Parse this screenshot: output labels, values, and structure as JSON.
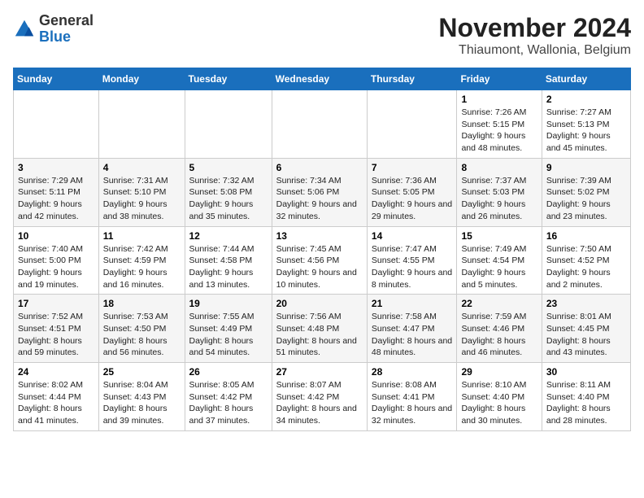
{
  "logo": {
    "text_general": "General",
    "text_blue": "Blue"
  },
  "header": {
    "month": "November 2024",
    "location": "Thiaumont, Wallonia, Belgium"
  },
  "days_of_week": [
    "Sunday",
    "Monday",
    "Tuesday",
    "Wednesday",
    "Thursday",
    "Friday",
    "Saturday"
  ],
  "weeks": [
    [
      {
        "day": "",
        "info": ""
      },
      {
        "day": "",
        "info": ""
      },
      {
        "day": "",
        "info": ""
      },
      {
        "day": "",
        "info": ""
      },
      {
        "day": "",
        "info": ""
      },
      {
        "day": "1",
        "info": "Sunrise: 7:26 AM\nSunset: 5:15 PM\nDaylight: 9 hours and 48 minutes."
      },
      {
        "day": "2",
        "info": "Sunrise: 7:27 AM\nSunset: 5:13 PM\nDaylight: 9 hours and 45 minutes."
      }
    ],
    [
      {
        "day": "3",
        "info": "Sunrise: 7:29 AM\nSunset: 5:11 PM\nDaylight: 9 hours and 42 minutes."
      },
      {
        "day": "4",
        "info": "Sunrise: 7:31 AM\nSunset: 5:10 PM\nDaylight: 9 hours and 38 minutes."
      },
      {
        "day": "5",
        "info": "Sunrise: 7:32 AM\nSunset: 5:08 PM\nDaylight: 9 hours and 35 minutes."
      },
      {
        "day": "6",
        "info": "Sunrise: 7:34 AM\nSunset: 5:06 PM\nDaylight: 9 hours and 32 minutes."
      },
      {
        "day": "7",
        "info": "Sunrise: 7:36 AM\nSunset: 5:05 PM\nDaylight: 9 hours and 29 minutes."
      },
      {
        "day": "8",
        "info": "Sunrise: 7:37 AM\nSunset: 5:03 PM\nDaylight: 9 hours and 26 minutes."
      },
      {
        "day": "9",
        "info": "Sunrise: 7:39 AM\nSunset: 5:02 PM\nDaylight: 9 hours and 23 minutes."
      }
    ],
    [
      {
        "day": "10",
        "info": "Sunrise: 7:40 AM\nSunset: 5:00 PM\nDaylight: 9 hours and 19 minutes."
      },
      {
        "day": "11",
        "info": "Sunrise: 7:42 AM\nSunset: 4:59 PM\nDaylight: 9 hours and 16 minutes."
      },
      {
        "day": "12",
        "info": "Sunrise: 7:44 AM\nSunset: 4:58 PM\nDaylight: 9 hours and 13 minutes."
      },
      {
        "day": "13",
        "info": "Sunrise: 7:45 AM\nSunset: 4:56 PM\nDaylight: 9 hours and 10 minutes."
      },
      {
        "day": "14",
        "info": "Sunrise: 7:47 AM\nSunset: 4:55 PM\nDaylight: 9 hours and 8 minutes."
      },
      {
        "day": "15",
        "info": "Sunrise: 7:49 AM\nSunset: 4:54 PM\nDaylight: 9 hours and 5 minutes."
      },
      {
        "day": "16",
        "info": "Sunrise: 7:50 AM\nSunset: 4:52 PM\nDaylight: 9 hours and 2 minutes."
      }
    ],
    [
      {
        "day": "17",
        "info": "Sunrise: 7:52 AM\nSunset: 4:51 PM\nDaylight: 8 hours and 59 minutes."
      },
      {
        "day": "18",
        "info": "Sunrise: 7:53 AM\nSunset: 4:50 PM\nDaylight: 8 hours and 56 minutes."
      },
      {
        "day": "19",
        "info": "Sunrise: 7:55 AM\nSunset: 4:49 PM\nDaylight: 8 hours and 54 minutes."
      },
      {
        "day": "20",
        "info": "Sunrise: 7:56 AM\nSunset: 4:48 PM\nDaylight: 8 hours and 51 minutes."
      },
      {
        "day": "21",
        "info": "Sunrise: 7:58 AM\nSunset: 4:47 PM\nDaylight: 8 hours and 48 minutes."
      },
      {
        "day": "22",
        "info": "Sunrise: 7:59 AM\nSunset: 4:46 PM\nDaylight: 8 hours and 46 minutes."
      },
      {
        "day": "23",
        "info": "Sunrise: 8:01 AM\nSunset: 4:45 PM\nDaylight: 8 hours and 43 minutes."
      }
    ],
    [
      {
        "day": "24",
        "info": "Sunrise: 8:02 AM\nSunset: 4:44 PM\nDaylight: 8 hours and 41 minutes."
      },
      {
        "day": "25",
        "info": "Sunrise: 8:04 AM\nSunset: 4:43 PM\nDaylight: 8 hours and 39 minutes."
      },
      {
        "day": "26",
        "info": "Sunrise: 8:05 AM\nSunset: 4:42 PM\nDaylight: 8 hours and 37 minutes."
      },
      {
        "day": "27",
        "info": "Sunrise: 8:07 AM\nSunset: 4:42 PM\nDaylight: 8 hours and 34 minutes."
      },
      {
        "day": "28",
        "info": "Sunrise: 8:08 AM\nSunset: 4:41 PM\nDaylight: 8 hours and 32 minutes."
      },
      {
        "day": "29",
        "info": "Sunrise: 8:10 AM\nSunset: 4:40 PM\nDaylight: 8 hours and 30 minutes."
      },
      {
        "day": "30",
        "info": "Sunrise: 8:11 AM\nSunset: 4:40 PM\nDaylight: 8 hours and 28 minutes."
      }
    ]
  ]
}
